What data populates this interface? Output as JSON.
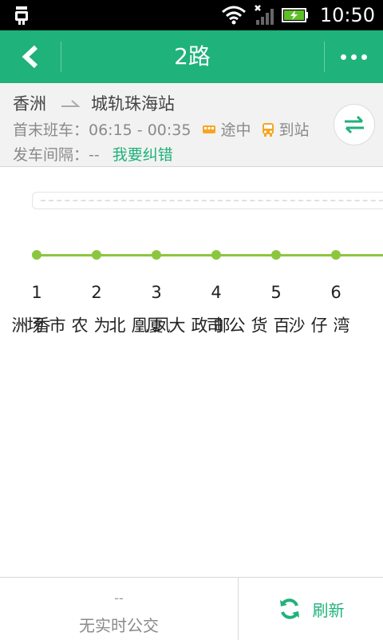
{
  "statusbar": {
    "time": "10:50"
  },
  "header": {
    "title": "2路"
  },
  "route": {
    "from": "香洲",
    "to": "城轨珠海站",
    "times_label": "首末班车：06:15 - 00:35",
    "legend_enroute": "途中",
    "legend_arrived": "到站",
    "interval_label": "发车间隔：--",
    "report_error": "我要纠错"
  },
  "colors": {
    "accent": "#1fb27a",
    "line": "#8cc63f",
    "bus_icon": "#f5a623"
  },
  "stops": [
    {
      "num": "1",
      "name": "香洲"
    },
    {
      "num": "2",
      "name": "为农市场"
    },
    {
      "num": "3",
      "name": "凤凰北"
    },
    {
      "num": "4",
      "name": "邮政大厦"
    },
    {
      "num": "5",
      "name": "百货公司"
    },
    {
      "num": "6",
      "name": "湾仔沙"
    }
  ],
  "footer": {
    "dashes": "--",
    "no_realtime": "无实时公交",
    "refresh": "刷新"
  }
}
